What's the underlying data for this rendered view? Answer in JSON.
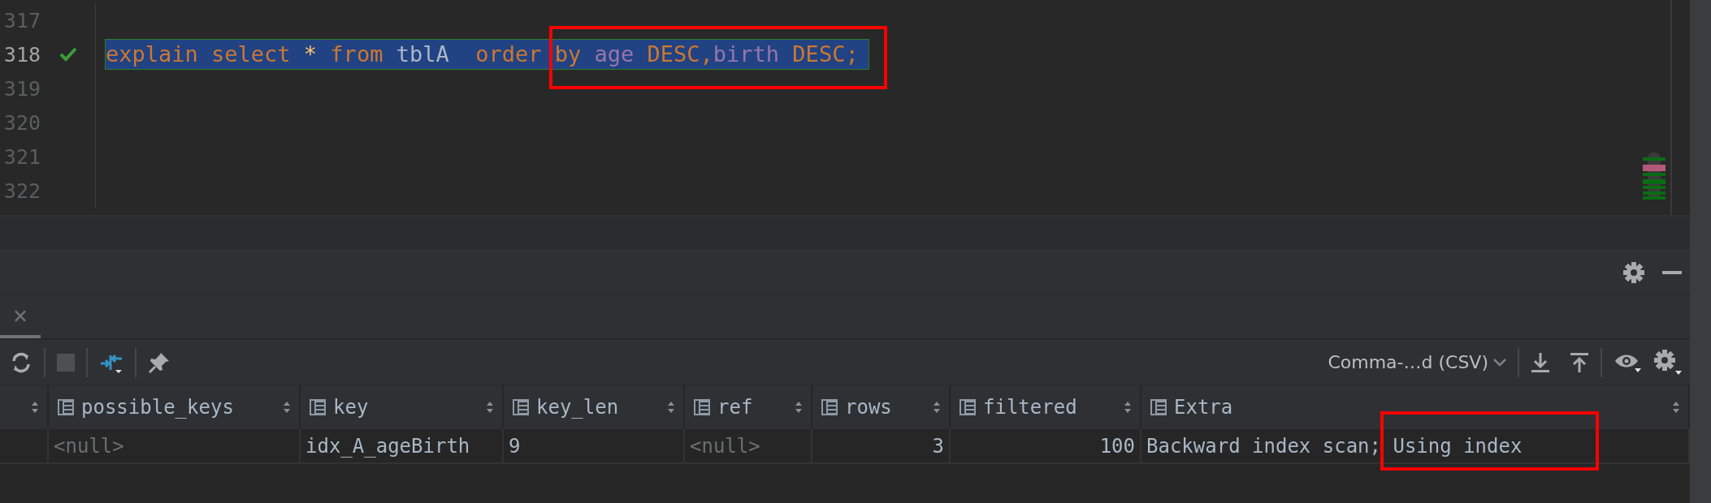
{
  "editor": {
    "highlighted": true,
    "lines": [
      {
        "number": "317",
        "current": false
      },
      {
        "number": "318",
        "current": true,
        "checked": true,
        "selected": true,
        "tokens": [
          {
            "kind": "keyword",
            "text": "explain"
          },
          {
            "kind": "keyword",
            "text": " select"
          },
          {
            "kind": "operator",
            "text": " *"
          },
          {
            "kind": "keyword",
            "text": " from"
          },
          {
            "kind": "identifier",
            "text": " tblA"
          },
          {
            "kind": "keyword",
            "text": "  order"
          },
          {
            "kind": "keyword",
            "text": " by"
          },
          {
            "kind": "column",
            "text": " age"
          },
          {
            "kind": "keyword",
            "text": " DESC"
          },
          {
            "kind": "keyword",
            "text": ","
          },
          {
            "kind": "column",
            "text": "birth"
          },
          {
            "kind": "keyword",
            "text": " DESC"
          },
          {
            "kind": "keyword",
            "text": ";"
          }
        ]
      },
      {
        "number": "319",
        "current": false
      },
      {
        "number": "320",
        "current": false
      },
      {
        "number": "321",
        "current": false
      },
      {
        "number": "322",
        "current": false
      }
    ]
  },
  "results": {
    "tab": {
      "close": "×",
      "selected": true
    },
    "export_format": "Comma-…d (CSV)",
    "table": {
      "columns": [
        {
          "label": "possible_keys",
          "numeric": false
        },
        {
          "label": "key",
          "numeric": false
        },
        {
          "label": "key_len",
          "numeric": false
        },
        {
          "label": "ref",
          "numeric": false
        },
        {
          "label": "rows",
          "numeric": true
        },
        {
          "label": "filtered",
          "numeric": true
        },
        {
          "label": "Extra",
          "numeric": false
        }
      ],
      "rows": [
        {
          "highlighted": true,
          "cells": [
            {
              "text": "<null>",
              "null": true
            },
            {
              "text": "idx_A_ageBirth",
              "null": false
            },
            {
              "text": "9",
              "null": false
            },
            {
              "text": "<null>",
              "null": true
            },
            {
              "text": "3",
              "null": false
            },
            {
              "text": "100",
              "null": false
            },
            {
              "text": "Backward index scan; Using index",
              "null": false
            }
          ]
        }
      ]
    }
  }
}
